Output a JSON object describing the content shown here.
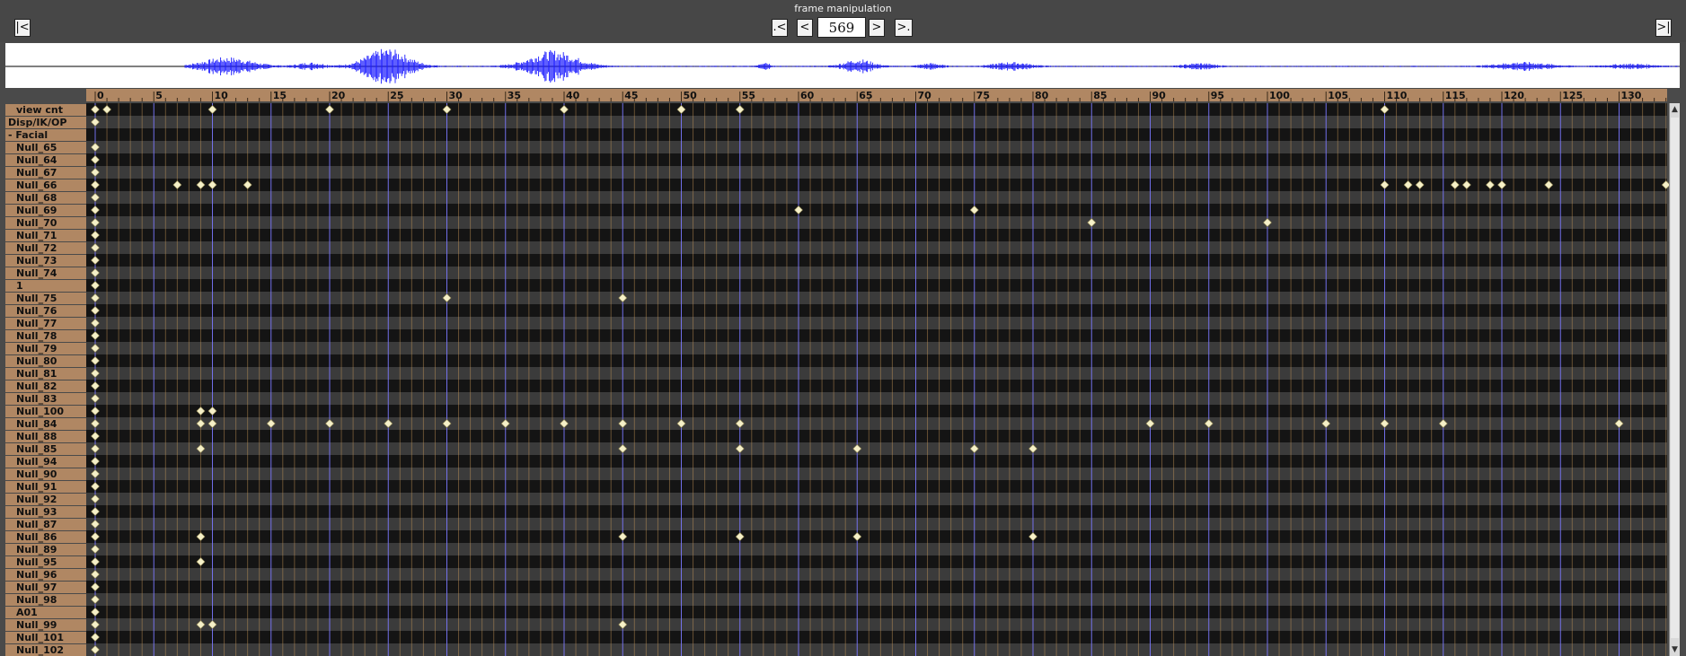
{
  "title": "frame manipulation",
  "frame": {
    "value": "569",
    "first_label": "|<",
    "prev_key_label": ".<",
    "prev_label": "<",
    "next_label": ">",
    "next_key_label": ">.",
    "last_label": ">|"
  },
  "colors": {
    "label_bg": "#b08763",
    "row_dark": "#141414",
    "row_light": "#3b3b3b",
    "grid_line": "#cc9a5a",
    "major_line": "#7b78ff",
    "key_diamond": "#f5f0c8",
    "waveform": "#1a1aff"
  },
  "ruler": {
    "ticks": [
      "0",
      "5",
      "10",
      "15",
      "20",
      "25",
      "30",
      "35",
      "40",
      "45",
      "50",
      "55",
      "60",
      "65",
      "70",
      "75",
      "80",
      "85",
      "90",
      "95",
      "100",
      "105",
      "110",
      "115",
      "120",
      "125",
      "130"
    ]
  },
  "tracks": [
    {
      "label": "view cnt",
      "indent": true,
      "keys": [
        0,
        1,
        10,
        20,
        30,
        40,
        50,
        55,
        110
      ]
    },
    {
      "label": "Disp/IK/OP",
      "indent": false,
      "keys": [
        0
      ]
    },
    {
      "label": "- Facial",
      "indent": false,
      "keys": []
    },
    {
      "label": "Null_65",
      "indent": true,
      "keys": [
        0
      ]
    },
    {
      "label": "Null_64",
      "indent": true,
      "keys": [
        0
      ]
    },
    {
      "label": "Null_67",
      "indent": true,
      "keys": [
        0
      ]
    },
    {
      "label": "Null_66",
      "indent": true,
      "keys": [
        0,
        7,
        9,
        10,
        13,
        110,
        112,
        113,
        116,
        117,
        119,
        120,
        124,
        134
      ]
    },
    {
      "label": "Null_68",
      "indent": true,
      "keys": [
        0
      ]
    },
    {
      "label": "Null_69",
      "indent": true,
      "keys": [
        0,
        60,
        75
      ]
    },
    {
      "label": "Null_70",
      "indent": true,
      "keys": [
        0,
        85,
        100
      ]
    },
    {
      "label": "Null_71",
      "indent": true,
      "keys": [
        0
      ]
    },
    {
      "label": "Null_72",
      "indent": true,
      "keys": [
        0
      ]
    },
    {
      "label": "Null_73",
      "indent": true,
      "keys": [
        0
      ]
    },
    {
      "label": "Null_74",
      "indent": true,
      "keys": [
        0
      ]
    },
    {
      "label": "1",
      "indent": true,
      "keys": [
        0
      ]
    },
    {
      "label": "Null_75",
      "indent": true,
      "keys": [
        0,
        30,
        45
      ]
    },
    {
      "label": "Null_76",
      "indent": true,
      "keys": [
        0
      ]
    },
    {
      "label": "Null_77",
      "indent": true,
      "keys": [
        0
      ]
    },
    {
      "label": "Null_78",
      "indent": true,
      "keys": [
        0
      ]
    },
    {
      "label": "Null_79",
      "indent": true,
      "keys": [
        0
      ]
    },
    {
      "label": "Null_80",
      "indent": true,
      "keys": [
        0
      ]
    },
    {
      "label": "Null_81",
      "indent": true,
      "keys": [
        0
      ]
    },
    {
      "label": "Null_82",
      "indent": true,
      "keys": [
        0
      ]
    },
    {
      "label": "Null_83",
      "indent": true,
      "keys": [
        0
      ]
    },
    {
      "label": "Null_100",
      "indent": true,
      "keys": [
        0,
        9,
        10
      ]
    },
    {
      "label": "Null_84",
      "indent": true,
      "keys": [
        0,
        9,
        10,
        15,
        20,
        25,
        30,
        35,
        40,
        45,
        50,
        55,
        90,
        95,
        105,
        110,
        115,
        130
      ]
    },
    {
      "label": "Null_88",
      "indent": true,
      "keys": [
        0
      ]
    },
    {
      "label": "Null_85",
      "indent": true,
      "keys": [
        0,
        9,
        45,
        55,
        65,
        75,
        80
      ]
    },
    {
      "label": "Null_94",
      "indent": true,
      "keys": [
        0
      ]
    },
    {
      "label": "Null_90",
      "indent": true,
      "keys": [
        0
      ]
    },
    {
      "label": "Null_91",
      "indent": true,
      "keys": [
        0
      ]
    },
    {
      "label": "Null_92",
      "indent": true,
      "keys": [
        0
      ]
    },
    {
      "label": "Null_93",
      "indent": true,
      "keys": [
        0
      ]
    },
    {
      "label": "Null_87",
      "indent": true,
      "keys": [
        0
      ]
    },
    {
      "label": "Null_86",
      "indent": true,
      "keys": [
        0,
        9,
        45,
        55,
        65,
        80
      ]
    },
    {
      "label": "Null_89",
      "indent": true,
      "keys": [
        0
      ]
    },
    {
      "label": "Null_95",
      "indent": true,
      "keys": [
        0,
        9
      ]
    },
    {
      "label": "Null_96",
      "indent": true,
      "keys": [
        0
      ]
    },
    {
      "label": "Null_97",
      "indent": true,
      "keys": [
        0
      ]
    },
    {
      "label": "Null_98",
      "indent": true,
      "keys": [
        0
      ]
    },
    {
      "label": "A01",
      "indent": true,
      "keys": [
        0
      ]
    },
    {
      "label": "Null_99",
      "indent": true,
      "keys": [
        0,
        9,
        10,
        45
      ]
    },
    {
      "label": "Null_101",
      "indent": true,
      "keys": [
        0
      ]
    },
    {
      "label": "Null_102",
      "indent": true,
      "keys": [
        0
      ]
    }
  ]
}
